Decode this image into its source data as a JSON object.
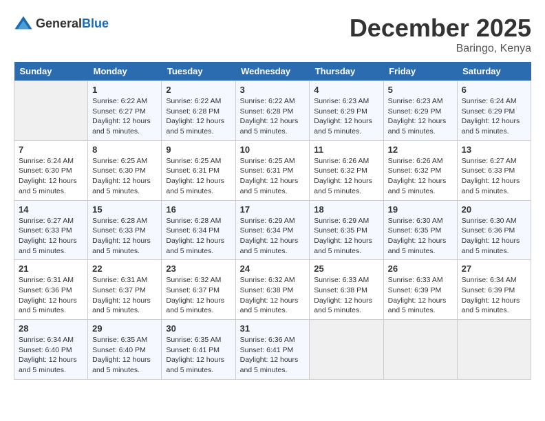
{
  "header": {
    "logo_general": "General",
    "logo_blue": "Blue",
    "month_year": "December 2025",
    "location": "Baringo, Kenya"
  },
  "days_of_week": [
    "Sunday",
    "Monday",
    "Tuesday",
    "Wednesday",
    "Thursday",
    "Friday",
    "Saturday"
  ],
  "weeks": [
    [
      {
        "day": "",
        "info": ""
      },
      {
        "day": "1",
        "info": "Sunrise: 6:22 AM\nSunset: 6:27 PM\nDaylight: 12 hours\nand 5 minutes."
      },
      {
        "day": "2",
        "info": "Sunrise: 6:22 AM\nSunset: 6:28 PM\nDaylight: 12 hours\nand 5 minutes."
      },
      {
        "day": "3",
        "info": "Sunrise: 6:22 AM\nSunset: 6:28 PM\nDaylight: 12 hours\nand 5 minutes."
      },
      {
        "day": "4",
        "info": "Sunrise: 6:23 AM\nSunset: 6:29 PM\nDaylight: 12 hours\nand 5 minutes."
      },
      {
        "day": "5",
        "info": "Sunrise: 6:23 AM\nSunset: 6:29 PM\nDaylight: 12 hours\nand 5 minutes."
      },
      {
        "day": "6",
        "info": "Sunrise: 6:24 AM\nSunset: 6:29 PM\nDaylight: 12 hours\nand 5 minutes."
      }
    ],
    [
      {
        "day": "7",
        "info": "Sunrise: 6:24 AM\nSunset: 6:30 PM\nDaylight: 12 hours\nand 5 minutes."
      },
      {
        "day": "8",
        "info": "Sunrise: 6:25 AM\nSunset: 6:30 PM\nDaylight: 12 hours\nand 5 minutes."
      },
      {
        "day": "9",
        "info": "Sunrise: 6:25 AM\nSunset: 6:31 PM\nDaylight: 12 hours\nand 5 minutes."
      },
      {
        "day": "10",
        "info": "Sunrise: 6:25 AM\nSunset: 6:31 PM\nDaylight: 12 hours\nand 5 minutes."
      },
      {
        "day": "11",
        "info": "Sunrise: 6:26 AM\nSunset: 6:32 PM\nDaylight: 12 hours\nand 5 minutes."
      },
      {
        "day": "12",
        "info": "Sunrise: 6:26 AM\nSunset: 6:32 PM\nDaylight: 12 hours\nand 5 minutes."
      },
      {
        "day": "13",
        "info": "Sunrise: 6:27 AM\nSunset: 6:33 PM\nDaylight: 12 hours\nand 5 minutes."
      }
    ],
    [
      {
        "day": "14",
        "info": "Sunrise: 6:27 AM\nSunset: 6:33 PM\nDaylight: 12 hours\nand 5 minutes."
      },
      {
        "day": "15",
        "info": "Sunrise: 6:28 AM\nSunset: 6:33 PM\nDaylight: 12 hours\nand 5 minutes."
      },
      {
        "day": "16",
        "info": "Sunrise: 6:28 AM\nSunset: 6:34 PM\nDaylight: 12 hours\nand 5 minutes."
      },
      {
        "day": "17",
        "info": "Sunrise: 6:29 AM\nSunset: 6:34 PM\nDaylight: 12 hours\nand 5 minutes."
      },
      {
        "day": "18",
        "info": "Sunrise: 6:29 AM\nSunset: 6:35 PM\nDaylight: 12 hours\nand 5 minutes."
      },
      {
        "day": "19",
        "info": "Sunrise: 6:30 AM\nSunset: 6:35 PM\nDaylight: 12 hours\nand 5 minutes."
      },
      {
        "day": "20",
        "info": "Sunrise: 6:30 AM\nSunset: 6:36 PM\nDaylight: 12 hours\nand 5 minutes."
      }
    ],
    [
      {
        "day": "21",
        "info": "Sunrise: 6:31 AM\nSunset: 6:36 PM\nDaylight: 12 hours\nand 5 minutes."
      },
      {
        "day": "22",
        "info": "Sunrise: 6:31 AM\nSunset: 6:37 PM\nDaylight: 12 hours\nand 5 minutes."
      },
      {
        "day": "23",
        "info": "Sunrise: 6:32 AM\nSunset: 6:37 PM\nDaylight: 12 hours\nand 5 minutes."
      },
      {
        "day": "24",
        "info": "Sunrise: 6:32 AM\nSunset: 6:38 PM\nDaylight: 12 hours\nand 5 minutes."
      },
      {
        "day": "25",
        "info": "Sunrise: 6:33 AM\nSunset: 6:38 PM\nDaylight: 12 hours\nand 5 minutes."
      },
      {
        "day": "26",
        "info": "Sunrise: 6:33 AM\nSunset: 6:39 PM\nDaylight: 12 hours\nand 5 minutes."
      },
      {
        "day": "27",
        "info": "Sunrise: 6:34 AM\nSunset: 6:39 PM\nDaylight: 12 hours\nand 5 minutes."
      }
    ],
    [
      {
        "day": "28",
        "info": "Sunrise: 6:34 AM\nSunset: 6:40 PM\nDaylight: 12 hours\nand 5 minutes."
      },
      {
        "day": "29",
        "info": "Sunrise: 6:35 AM\nSunset: 6:40 PM\nDaylight: 12 hours\nand 5 minutes."
      },
      {
        "day": "30",
        "info": "Sunrise: 6:35 AM\nSunset: 6:41 PM\nDaylight: 12 hours\nand 5 minutes."
      },
      {
        "day": "31",
        "info": "Sunrise: 6:36 AM\nSunset: 6:41 PM\nDaylight: 12 hours\nand 5 minutes."
      },
      {
        "day": "",
        "info": ""
      },
      {
        "day": "",
        "info": ""
      },
      {
        "day": "",
        "info": ""
      }
    ]
  ]
}
